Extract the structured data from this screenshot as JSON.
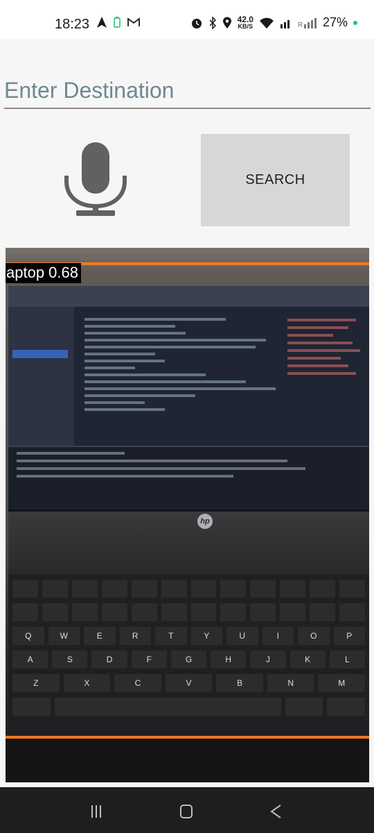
{
  "status_bar": {
    "time": "18:23",
    "net_speed": "42.0",
    "net_unit": "KB/S",
    "battery": "27%"
  },
  "destination": {
    "placeholder": "Enter Destination"
  },
  "search_button": {
    "label": "SEARCH"
  },
  "detection": {
    "label": "aptop 0.68",
    "box_color": "#f47a20"
  },
  "keyboard_rows": [
    [
      "Q",
      "W",
      "E",
      "R",
      "T",
      "Y",
      "U",
      "I",
      "O",
      "P"
    ],
    [
      "A",
      "S",
      "D",
      "F",
      "G",
      "H",
      "J",
      "K",
      "L"
    ],
    [
      "Z",
      "X",
      "C",
      "V",
      "B",
      "N",
      "M"
    ]
  ],
  "colors": {
    "input_text": "#6f8893",
    "search_bg": "#d7d7d7",
    "nav_bg": "#1e1e1e"
  },
  "icons": {
    "mic": "microphone-icon",
    "nav_recents": "recents-icon",
    "nav_home": "home-icon",
    "nav_back": "back-icon"
  }
}
